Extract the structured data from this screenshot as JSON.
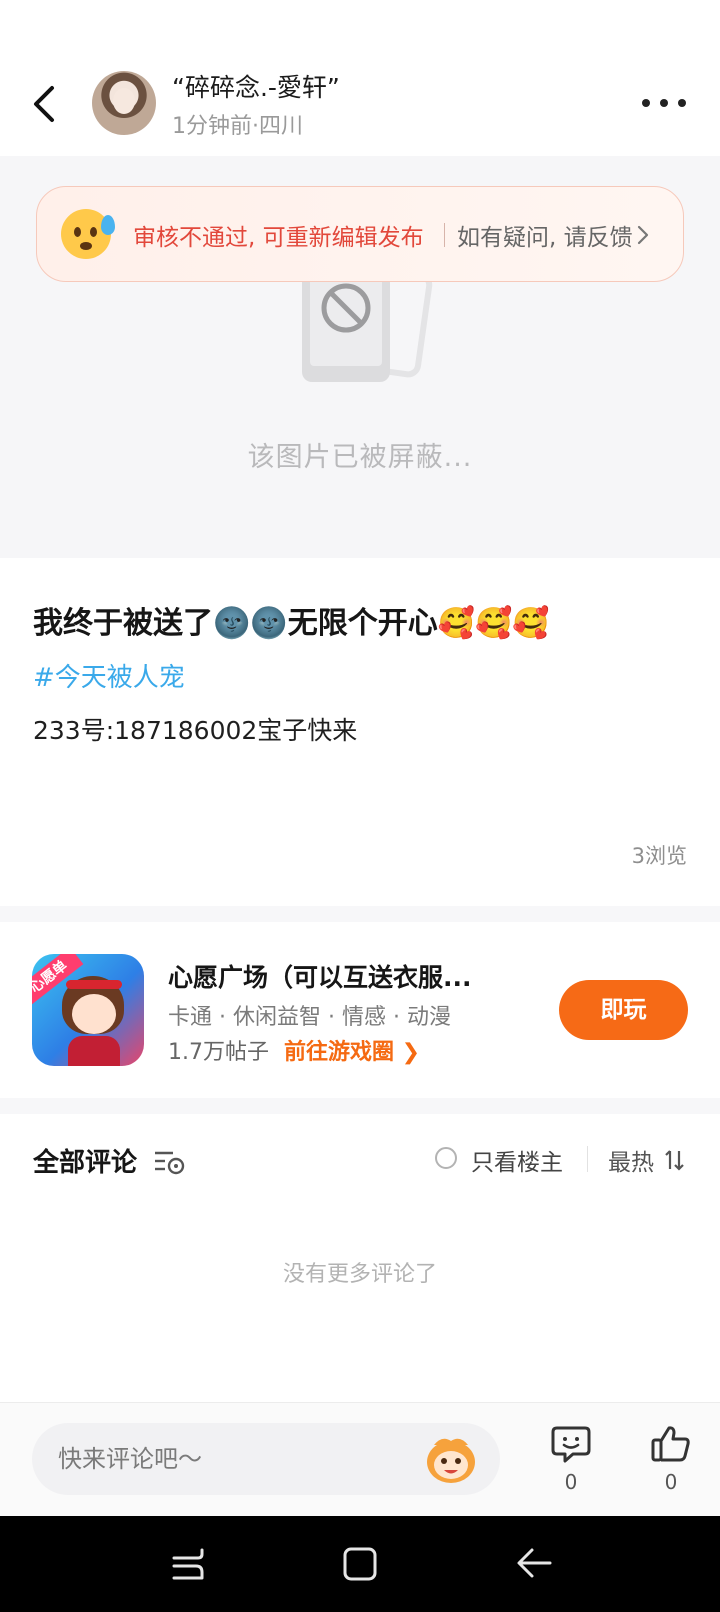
{
  "header": {
    "username": "“碎碎念.-愛轩”",
    "post_meta": "1分钟前·四川"
  },
  "review_banner": {
    "status_text": "审核不通过, 可重新编辑发布",
    "feedback_text": "如有疑问, 请反馈"
  },
  "media": {
    "blocked_text": "该图片已被屏蔽..."
  },
  "post": {
    "title": "我终于被送了🌚🌚无限个开心🥰🥰🥰",
    "hashtag": "#今天被人宠",
    "body": "233号:187186002宝子快来",
    "views": "3浏览"
  },
  "game_card": {
    "icon_ribbon": "心愿单",
    "title": "心愿广场（可以互送衣服...",
    "tags": "卡通 · 休闲益智 · 情感 · 动漫",
    "posts": "1.7万帖子",
    "circle_link": "前往游戏圈 ❯",
    "play_label": "即玩"
  },
  "comments": {
    "title": "全部评论",
    "op_only": "只看楼主",
    "sort": "最热",
    "empty": "没有更多评论了"
  },
  "bottom_bar": {
    "input_placeholder": "快来评论吧～",
    "comment_count": "0",
    "like_count": "0"
  },
  "colors": {
    "accent": "#f66a16",
    "hashtag": "#3aa9ea",
    "warning": "#e2483b"
  },
  "icons": [
    "back-arrow-icon",
    "more-icon",
    "sweat-emoji-icon",
    "chevron-right-icon",
    "blocked-image-icon",
    "filter-icon",
    "sort-icon",
    "monkey-emoji-icon",
    "comment-icon",
    "thumbs-up-icon"
  ]
}
